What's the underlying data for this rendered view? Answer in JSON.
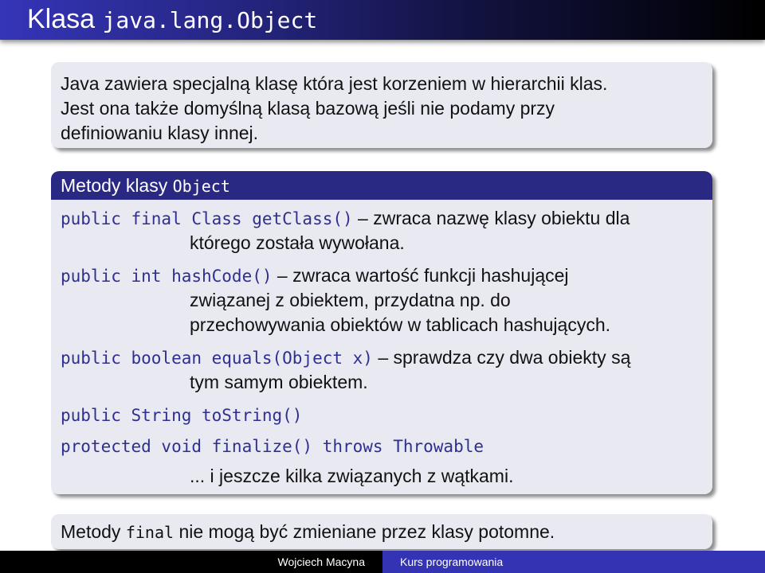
{
  "slide": {
    "title_prefix": "Klasa",
    "title_code": "java.lang.Object"
  },
  "intro": {
    "lines": [
      "Java zawiera specjalną klasę która jest korzeniem w hierarchii klas.",
      "Jest ona także domyślną klasą bazową jeśli nie podamy przy",
      "definiowaniu klasy innej."
    ]
  },
  "methods_block": {
    "header_text": "Metody klasy",
    "header_code": "Object",
    "entries": [
      {
        "signature": "public final Class getClass()",
        "description": "– zwraca nazwę klasy obiektu dla",
        "continuation": [
          "którego została wywołana."
        ]
      },
      {
        "signature": "public int hashCode()",
        "description": "– zwraca wartość funkcji hashującej",
        "continuation": [
          "związanej z obiektem, przydatna np. do",
          "przechowywania obiektów w tablicach hashujących."
        ]
      },
      {
        "signature": "public boolean equals(Object x)",
        "description": "– sprawdza czy dwa obiekty są",
        "continuation": [
          "tym samym obiektem."
        ]
      },
      {
        "signature": "public String toString()",
        "description": "",
        "continuation": []
      },
      {
        "signature": "protected void finalize() throws Throwable",
        "description": "",
        "continuation": [
          "... i jeszcze kilka związanych z wątkami."
        ]
      }
    ]
  },
  "note": {
    "prefix": "Metody",
    "code": "final",
    "suffix": "nie mogą być zmieniane przez klasy potomne."
  },
  "footer": {
    "author": "Wojciech Macyna",
    "course": "Kurs programowania"
  },
  "colors": {
    "accent": "#292984",
    "code": "#2f2f8f",
    "block_bg": "#e9e9f2",
    "footer_right": "#3333b3"
  }
}
